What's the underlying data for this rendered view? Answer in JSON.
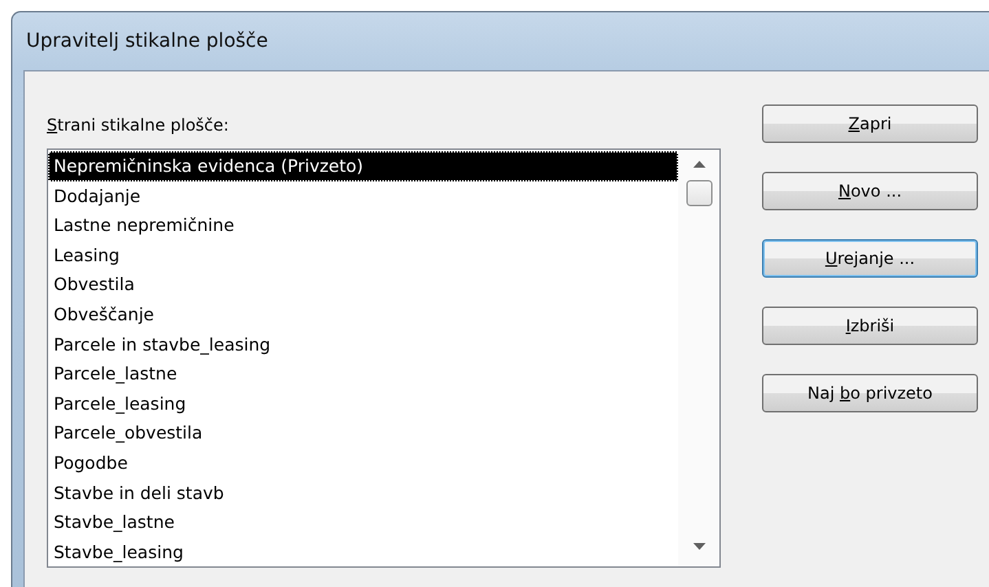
{
  "window": {
    "title": "Upravitelj stikalne plošče"
  },
  "list": {
    "label": {
      "key": "S",
      "after": "trani stikalne plošče:"
    },
    "items": [
      {
        "text": "Nepremičninska evidenca (Privzeto)",
        "selected": true
      },
      {
        "text": "Dodajanje",
        "selected": false
      },
      {
        "text": "Lastne nepremičnine",
        "selected": false
      },
      {
        "text": "Leasing",
        "selected": false
      },
      {
        "text": "Obvestila",
        "selected": false
      },
      {
        "text": "Obveščanje",
        "selected": false
      },
      {
        "text": "Parcele in stavbe_leasing",
        "selected": false
      },
      {
        "text": "Parcele_lastne",
        "selected": false
      },
      {
        "text": "Parcele_leasing",
        "selected": false
      },
      {
        "text": "Parcele_obvestila",
        "selected": false
      },
      {
        "text": "Pogodbe",
        "selected": false
      },
      {
        "text": "Stavbe in deli stavb",
        "selected": false
      },
      {
        "text": "Stavbe_lastne",
        "selected": false
      },
      {
        "text": "Stavbe_leasing",
        "selected": false
      }
    ]
  },
  "buttons": [
    {
      "label": {
        "key": "Z",
        "after": "apri"
      },
      "default": false
    },
    {
      "label": {
        "key": "N",
        "after": "ovo ..."
      },
      "default": false
    },
    {
      "label": {
        "key": "U",
        "after": "rejanje ..."
      },
      "default": true
    },
    {
      "label": {
        "key": "I",
        "after": "zbriši"
      },
      "default": false
    },
    {
      "label": {
        "before": "Naj ",
        "key": "b",
        "after": "o privzeto"
      },
      "default": false
    }
  ]
}
